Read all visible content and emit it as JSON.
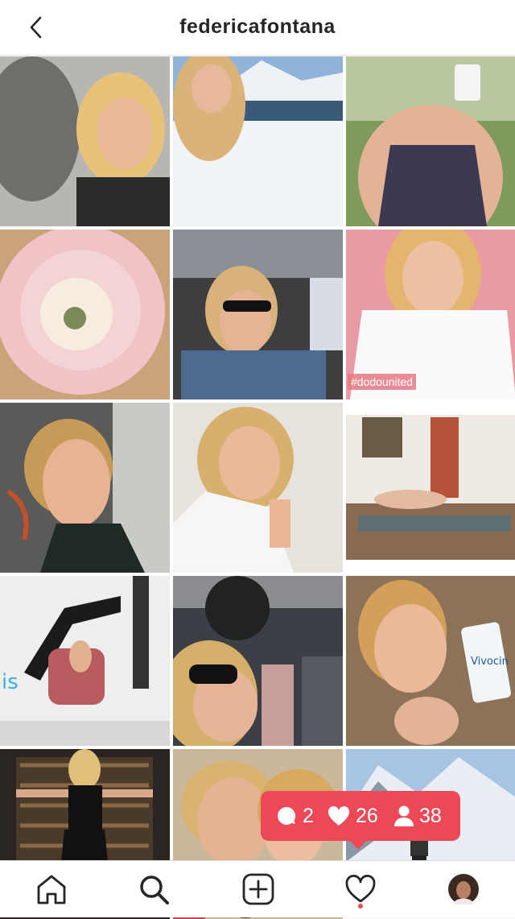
{
  "header": {
    "title": "federicafontana"
  },
  "grid": {
    "tiles": [
      {
        "alt": "portrait-blonde-woman-smiling"
      },
      {
        "alt": "snowy-mountain-lake"
      },
      {
        "alt": "woman-with-coffee-cup"
      },
      {
        "alt": "pink-ranunculus-flower"
      },
      {
        "alt": "selfie-in-car-sunglasses"
      },
      {
        "alt": "woman-white-shirt",
        "tag": "#dodounited"
      },
      {
        "alt": "close-up-face-selfie"
      },
      {
        "alt": "woman-chin-on-hand"
      },
      {
        "alt": "yoga-pose-room"
      },
      {
        "alt": "gym-stretch-trainer"
      },
      {
        "alt": "car-selfie-sunglasses"
      },
      {
        "alt": "woman-with-cream-tube"
      },
      {
        "alt": "pilates-back-exercise"
      },
      {
        "alt": "mother-daughter-selfie"
      },
      {
        "alt": "snowy-mountain-hike"
      }
    ]
  },
  "activity_badge": {
    "comments": "2",
    "likes": "26",
    "followers": "38"
  },
  "nav": {
    "items": [
      "home-icon",
      "search-icon",
      "add-post-icon",
      "activity-heart-icon",
      "profile-avatar"
    ]
  }
}
